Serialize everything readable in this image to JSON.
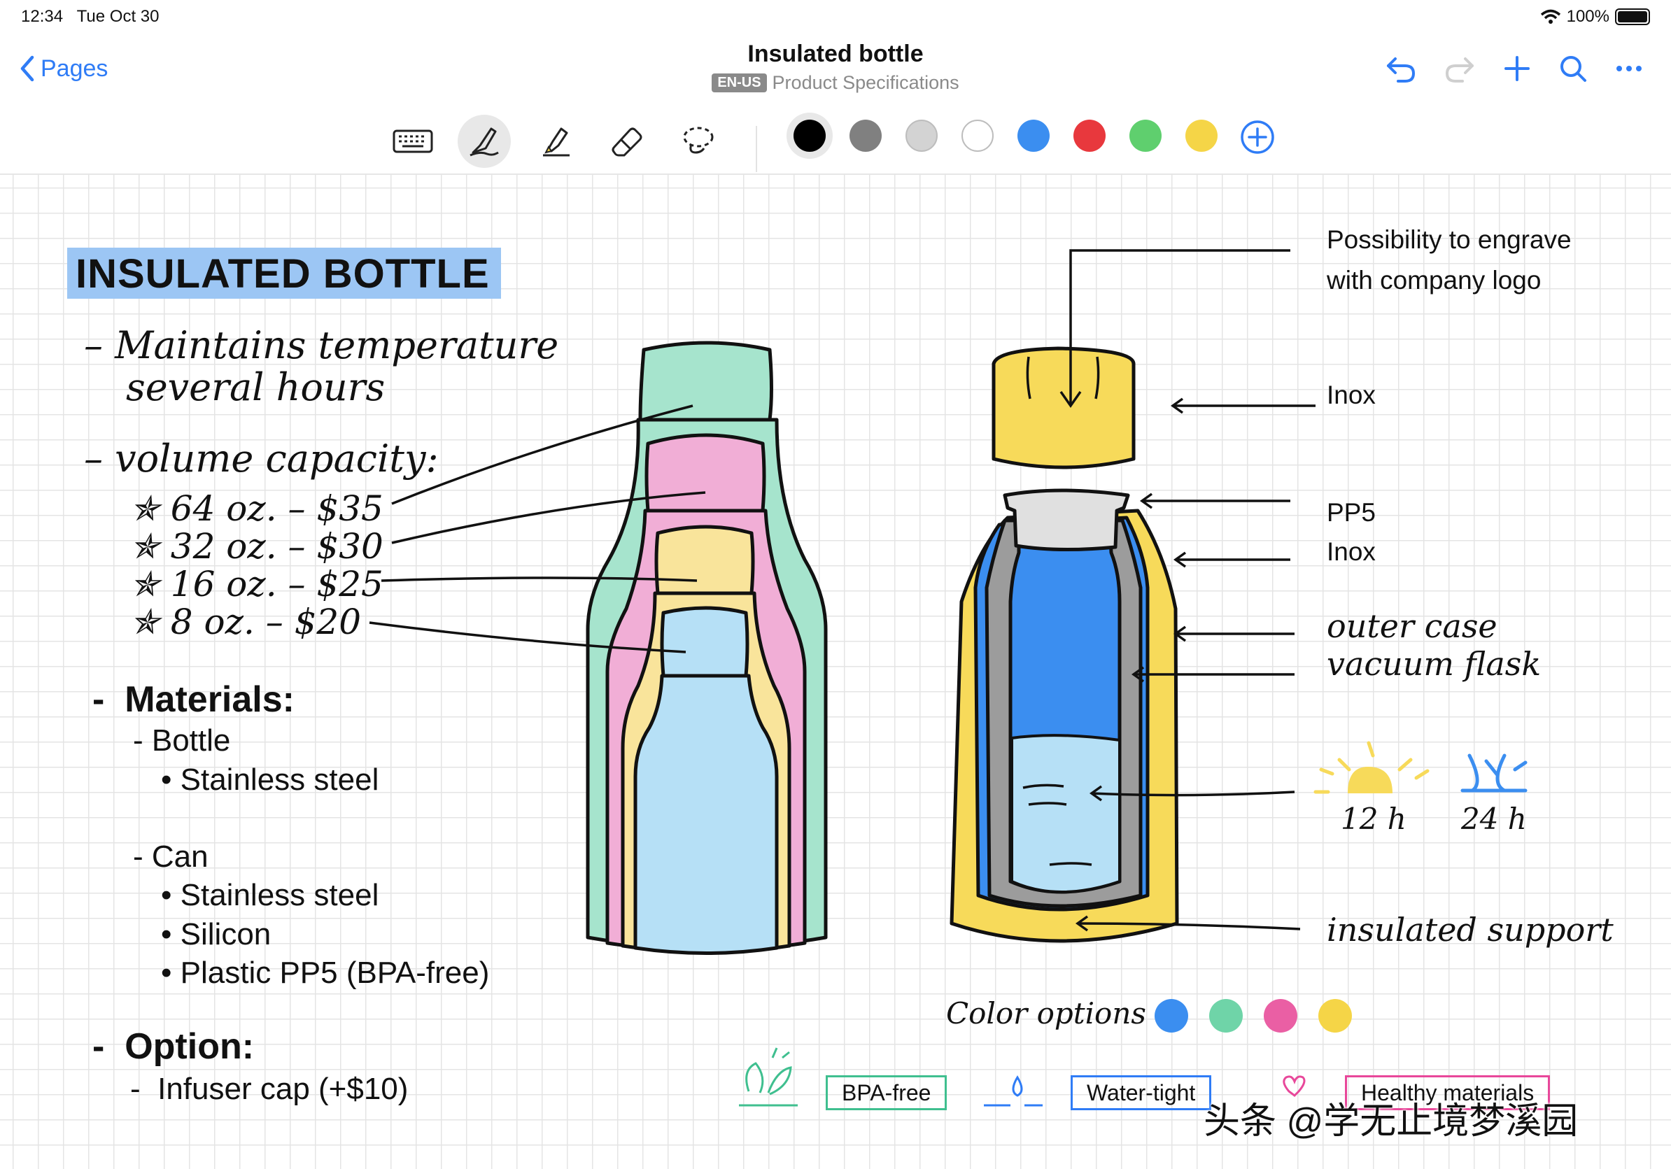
{
  "status": {
    "time": "12:34",
    "date": "Tue Oct 30",
    "battery": "100%"
  },
  "nav": {
    "back_label": "Pages",
    "title": "Insulated bottle",
    "lang": "EN-US",
    "subtitle": "Product Specifications"
  },
  "toolbar": {
    "tools": [
      "keyboard-icon",
      "pen-icon",
      "highlighter-icon",
      "eraser-icon",
      "lasso-icon"
    ],
    "colors": [
      "#000000",
      "#808080",
      "#d3d3d3",
      "#ffffff",
      "#3b8ef0",
      "#e8383d",
      "#5fcf6e",
      "#f5d547"
    ]
  },
  "note": {
    "heading": "INSULATED BOTTLE",
    "hand": {
      "temp1": "– Maintains temperature",
      "temp2": "several hours",
      "volume": "– volume capacity:",
      "v1": "✯ 64 oz. – $35",
      "v2": "✯ 32 oz. – $30",
      "v3": "✯ 16 oz. – $25",
      "v4": "✯ 8 oz. – $20"
    },
    "materials": {
      "title": "Materials:",
      "bottle": "- Bottle",
      "bottle_items": [
        "Stainless steel"
      ],
      "can": "- Can",
      "can_items": [
        "Stainless steel",
        "Silicon",
        "Plastic PP5 (BPA-free)"
      ]
    },
    "option": {
      "title": "Option:",
      "item": "Infuser cap (+$10)"
    }
  },
  "diagram": {
    "engrave1": "Possibility to engrave",
    "engrave2": "with company logo",
    "inox1": "Inox",
    "pp5": "PP5",
    "inox2": "Inox",
    "outer": "outer case",
    "vacuum": "vacuum flask",
    "sun": "12 h",
    "cold": "24 h",
    "support": "insulated support",
    "color_options": "Color options",
    "color_dots": [
      "#3b8ef0",
      "#6fd4a8",
      "#ea5fa4",
      "#f5d547"
    ],
    "tags": [
      {
        "label": "BPA-free",
        "color": "#3fbf8f"
      },
      {
        "label": "Water-tight",
        "color": "#2f7cf6"
      },
      {
        "label": "Healthy materials",
        "color": "#e8479a"
      }
    ]
  },
  "watermark": "头条 @学无止境梦溪园"
}
